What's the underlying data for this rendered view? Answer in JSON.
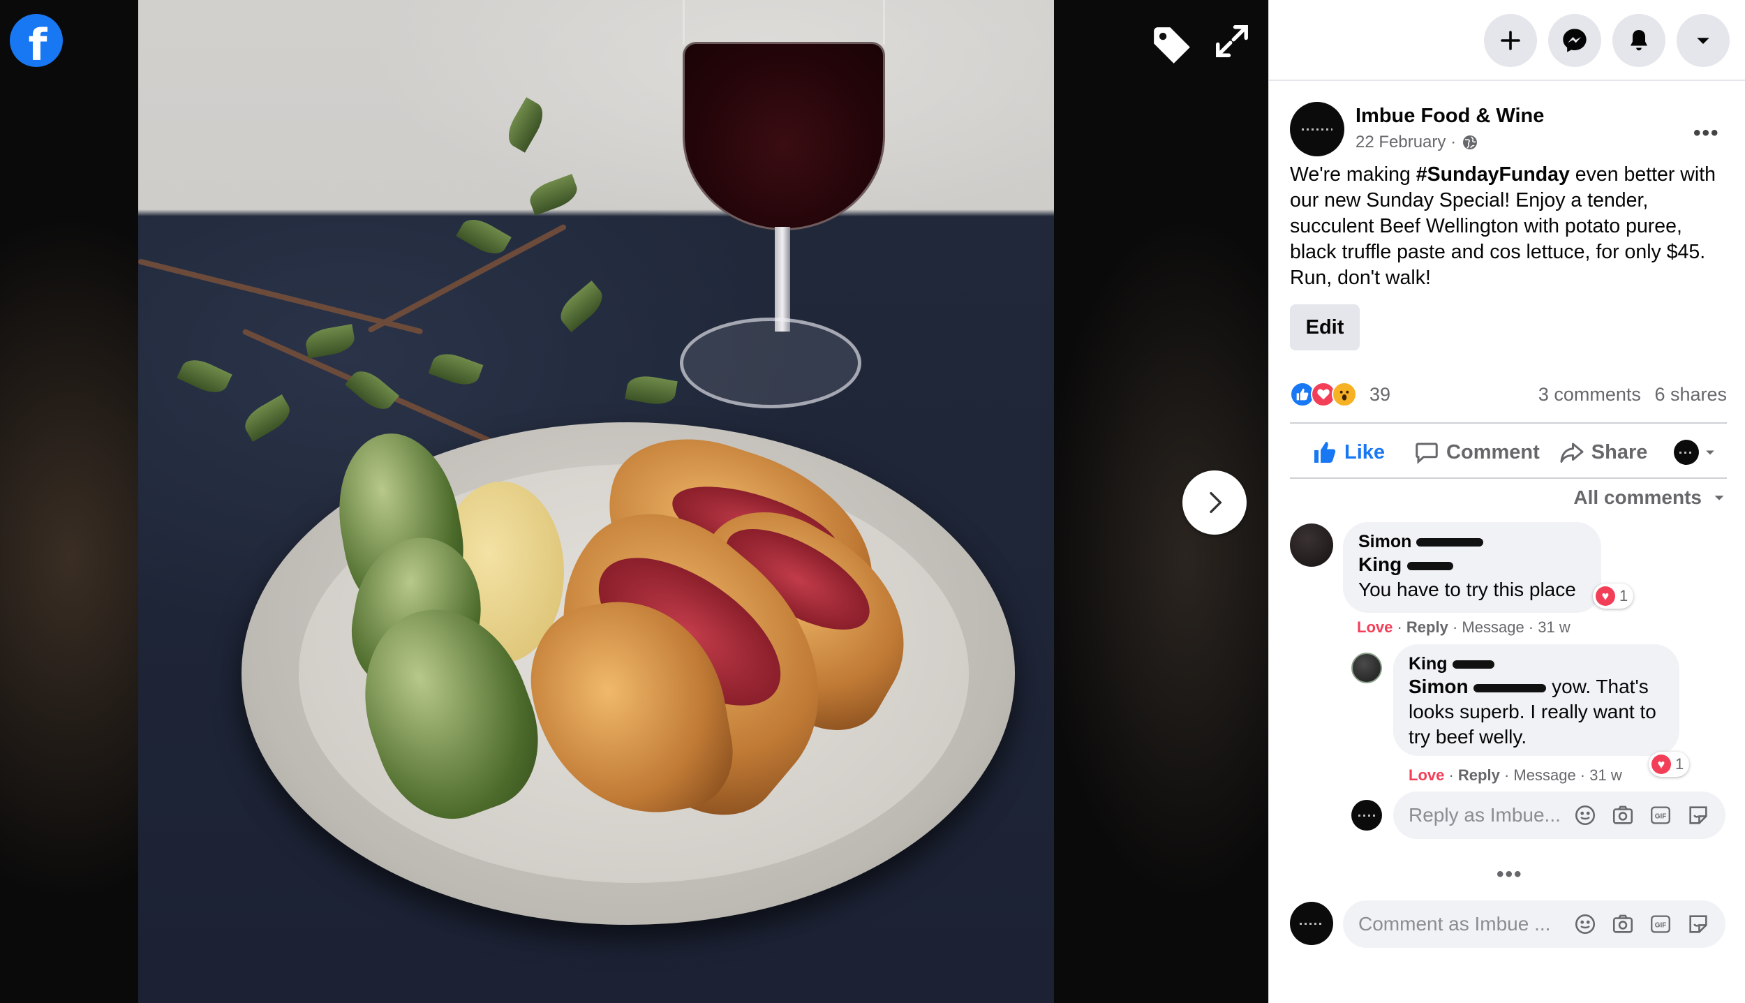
{
  "post": {
    "page_name": "Imbue Food & Wine",
    "date": "22 February ·",
    "text_parts": {
      "p1": "We're making ",
      "hashtag": "#SundayFunday",
      "p2": " even better with our new Sunday Special! Enjoy a tender, succulent Beef Wellington with potato puree, black truffle paste and cos lettuce, for only $45. Run, don't walk!"
    },
    "edit_label": "Edit",
    "reaction_count": "39",
    "comments_count": "3 comments",
    "shares_count": "6 shares",
    "actions": {
      "like": "Like",
      "comment": "Comment",
      "share": "Share"
    },
    "comment_filter": "All comments",
    "colors": {
      "like_blue": "#1877f2",
      "love_red": "#f33e58",
      "haha_yellow": "#f7b125"
    }
  },
  "comments": [
    {
      "author": "Simon",
      "mention": "King",
      "text": "You have to try this place",
      "reaction_count": "1",
      "love": "Love",
      "reply": "Reply",
      "message": "Message",
      "age": "31 w"
    },
    {
      "author": "King",
      "mention": "Simon",
      "text_inline": " yow. That's",
      "text_rest": "looks superb. I really want to try beef welly.",
      "reaction_count": "1",
      "love": "Love",
      "reply": "Reply",
      "message": "Message",
      "age": "31 w"
    }
  ],
  "inputs": {
    "reply_placeholder": "Reply as Imbue...",
    "comment_placeholder": "Comment as Imbue ..."
  },
  "icons": [
    "facebook-logo-icon",
    "tag-icon",
    "expand-icon",
    "chevron-right-icon",
    "plus-icon",
    "messenger-icon",
    "bell-icon",
    "caret-down-icon",
    "globe-icon",
    "emoji-icon",
    "camera-icon",
    "gif-icon",
    "sticker-icon"
  ]
}
